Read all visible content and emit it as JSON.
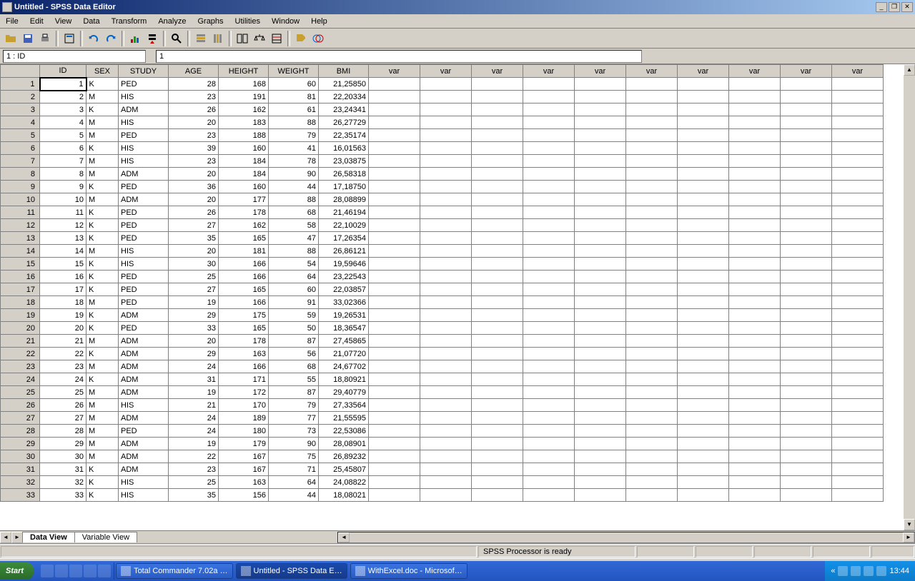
{
  "window": {
    "title": "Untitled - SPSS Data Editor"
  },
  "menu": [
    "File",
    "Edit",
    "View",
    "Data",
    "Transform",
    "Analyze",
    "Graphs",
    "Utilities",
    "Window",
    "Help"
  ],
  "cellref": {
    "ref": "1 : ID",
    "value": "1"
  },
  "columns": [
    "ID",
    "SEX",
    "STUDY",
    "AGE",
    "HEIGHT",
    "WEIGHT",
    "BMI"
  ],
  "empty_col": "var",
  "rows": [
    [
      1,
      "K",
      "PED",
      28,
      168,
      60,
      "21,25850"
    ],
    [
      2,
      "M",
      "HIS",
      23,
      191,
      81,
      "22,20334"
    ],
    [
      3,
      "K",
      "ADM",
      26,
      162,
      61,
      "23,24341"
    ],
    [
      4,
      "M",
      "HIS",
      20,
      183,
      88,
      "26,27729"
    ],
    [
      5,
      "M",
      "PED",
      23,
      188,
      79,
      "22,35174"
    ],
    [
      6,
      "K",
      "HIS",
      39,
      160,
      41,
      "16,01563"
    ],
    [
      7,
      "M",
      "HIS",
      23,
      184,
      78,
      "23,03875"
    ],
    [
      8,
      "M",
      "ADM",
      20,
      184,
      90,
      "26,58318"
    ],
    [
      9,
      "K",
      "PED",
      36,
      160,
      44,
      "17,18750"
    ],
    [
      10,
      "M",
      "ADM",
      20,
      177,
      88,
      "28,08899"
    ],
    [
      11,
      "K",
      "PED",
      26,
      178,
      68,
      "21,46194"
    ],
    [
      12,
      "K",
      "PED",
      27,
      162,
      58,
      "22,10029"
    ],
    [
      13,
      "K",
      "PED",
      35,
      165,
      47,
      "17,26354"
    ],
    [
      14,
      "M",
      "HIS",
      20,
      181,
      88,
      "26,86121"
    ],
    [
      15,
      "K",
      "HIS",
      30,
      166,
      54,
      "19,59646"
    ],
    [
      16,
      "K",
      "PED",
      25,
      166,
      64,
      "23,22543"
    ],
    [
      17,
      "K",
      "PED",
      27,
      165,
      60,
      "22,03857"
    ],
    [
      18,
      "M",
      "PED",
      19,
      166,
      91,
      "33,02366"
    ],
    [
      19,
      "K",
      "ADM",
      29,
      175,
      59,
      "19,26531"
    ],
    [
      20,
      "K",
      "PED",
      33,
      165,
      50,
      "18,36547"
    ],
    [
      21,
      "M",
      "ADM",
      20,
      178,
      87,
      "27,45865"
    ],
    [
      22,
      "K",
      "ADM",
      29,
      163,
      56,
      "21,07720"
    ],
    [
      23,
      "M",
      "ADM",
      24,
      166,
      68,
      "24,67702"
    ],
    [
      24,
      "K",
      "ADM",
      31,
      171,
      55,
      "18,80921"
    ],
    [
      25,
      "M",
      "ADM",
      19,
      172,
      87,
      "29,40779"
    ],
    [
      26,
      "M",
      "HIS",
      21,
      170,
      79,
      "27,33564"
    ],
    [
      27,
      "M",
      "ADM",
      24,
      189,
      77,
      "21,55595"
    ],
    [
      28,
      "M",
      "PED",
      24,
      180,
      73,
      "22,53086"
    ],
    [
      29,
      "M",
      "ADM",
      19,
      179,
      90,
      "28,08901"
    ],
    [
      30,
      "M",
      "ADM",
      22,
      167,
      75,
      "26,89232"
    ],
    [
      31,
      "K",
      "ADM",
      23,
      167,
      71,
      "25,45807"
    ],
    [
      32,
      "K",
      "HIS",
      25,
      163,
      64,
      "24,08822"
    ],
    [
      33,
      "K",
      "HIS",
      35,
      156,
      44,
      "18,08021"
    ]
  ],
  "tabs": {
    "data_view": "Data View",
    "variable_view": "Variable View"
  },
  "status": {
    "msg": "SPSS Processor  is ready"
  },
  "taskbar": {
    "start": "Start",
    "items": [
      "Total Commander 7.02a …",
      "Untitled - SPSS Data E…",
      "WithExcel.doc - Microsof…"
    ],
    "clock": "13:44"
  }
}
